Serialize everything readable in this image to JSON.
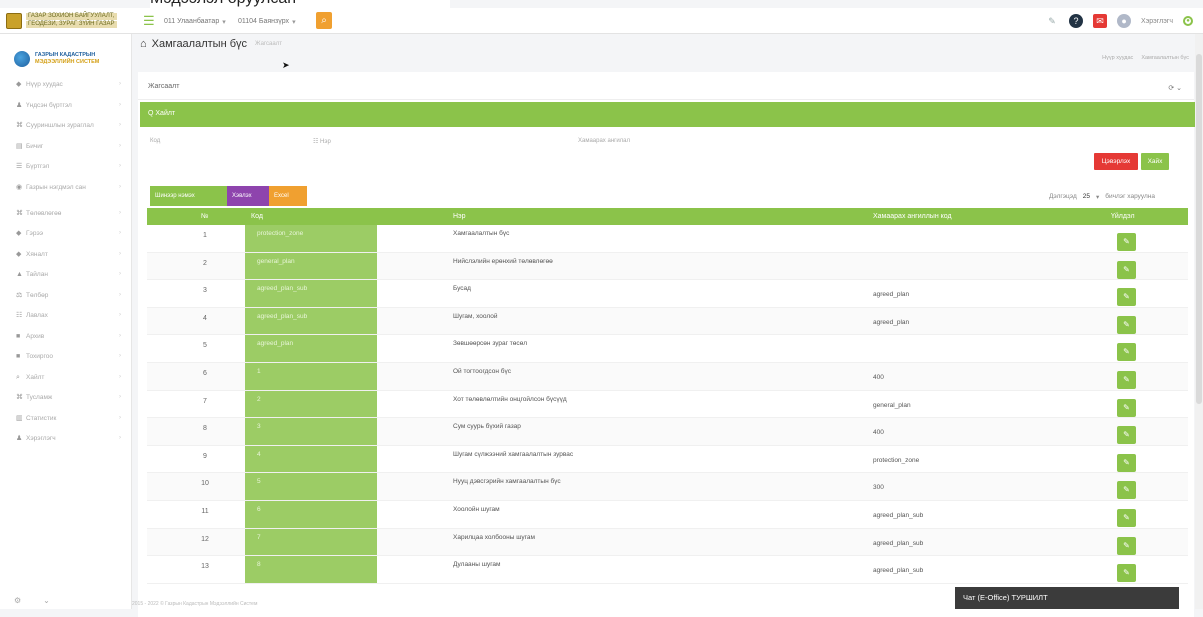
{
  "top_fragment": "Мэдээлэл оруулсан",
  "topbar": {
    "brand_lines": [
      "ГАЗАР ЗОХИОН БАЙГУУЛАЛТ,",
      "ГЕОДЕЗИ, ЗУРАГ ЗҮЙН ГАЗАР"
    ],
    "aimag": "011 Улаанбаатар",
    "district": "01104 Баянзүрх",
    "user": "Хэрэглэгч",
    "icons": [
      "paperclip-icon",
      "help-icon",
      "notification-icon",
      "user-icon",
      "power-icon"
    ]
  },
  "sidebar": {
    "sys_title": [
      "ГАЗРЫН КАДАСТРЫН",
      "МЭДЭЭЛЛИЙН СИСТЕМ"
    ],
    "items": [
      {
        "icon": "home-icon",
        "label": "Нүүр хуудас",
        "glyph": "◆",
        "two": false
      },
      {
        "icon": "user-icon",
        "label": "Үндсэн бүртгэл",
        "glyph": "♟",
        "two": false
      },
      {
        "icon": "map-icon",
        "label": "Сууриншлын зураглал",
        "glyph": "⌘",
        "two": false
      },
      {
        "icon": "doc-icon",
        "label": "Бичиг",
        "glyph": "▤",
        "two": false
      },
      {
        "icon": "list-icon",
        "label": "Бүртгэл",
        "glyph": "☰",
        "two": false
      },
      {
        "icon": "globe-icon",
        "label": "Газрын нэгдмэл сан",
        "glyph": "◉",
        "two": true
      },
      {
        "icon": "settings-icon",
        "label": "Төлөвлөгөө",
        "glyph": "⌘",
        "two": false
      },
      {
        "icon": "file-icon",
        "label": "Гэрээ",
        "glyph": "◆",
        "two": false
      },
      {
        "icon": "check-icon",
        "label": "Хяналт",
        "glyph": "◆",
        "two": false
      },
      {
        "icon": "report-icon",
        "label": "Тайлан",
        "glyph": "▲",
        "two": false
      },
      {
        "icon": "tax-icon",
        "label": "Төлбөр",
        "glyph": "⚖",
        "two": false
      },
      {
        "icon": "table-icon",
        "label": "Лавлах",
        "glyph": "☷",
        "two": false
      },
      {
        "icon": "archive-icon",
        "label": "Архив",
        "glyph": "■",
        "two": false
      },
      {
        "icon": "config-icon",
        "label": "Тохиргоо",
        "glyph": "■",
        "two": false
      },
      {
        "icon": "search-icon",
        "label": "Хайлт",
        "glyph": "⌕",
        "two": false
      },
      {
        "icon": "help-icon",
        "label": "Тусламж",
        "glyph": "⌘",
        "two": false
      },
      {
        "icon": "stats-icon",
        "label": "Статистик",
        "glyph": "▥",
        "two": false
      },
      {
        "icon": "user-icon",
        "label": "Хэрэглэгч",
        "glyph": "♟",
        "two": false
      }
    ]
  },
  "main": {
    "title": "Хамгаалалтын бүс",
    "subtitle": "Жагсаалт",
    "crumbs": [
      "Нүүр хуудас",
      "Хамгаалалтын бүс"
    ],
    "card_label": "Жагсаалт",
    "filter_label": "Q Хайлт",
    "filter_code_label": "Код",
    "filter_name_label": "Нэр",
    "filter_parent_label": "Хамаарах ангилал",
    "btn_clear": "Цэвэрлэх",
    "btn_search": "Хайх",
    "btn_add": "Шинээр нэмэх",
    "btn_print": "Хэвлэх",
    "btn_excel": "Excel",
    "paging_label": "Дэлгэцэд",
    "paging_count": "25",
    "paging_suffix": "бичлэг харуулна",
    "table_headers": [
      "№",
      "Код",
      "Нэр",
      "Хамаарах ангиллын код",
      "Үйлдэл"
    ],
    "rows": [
      {
        "no": "1",
        "code": "protection_zone",
        "name": "Хамгаалалтын бүс",
        "parent": ""
      },
      {
        "no": "2",
        "code": "general_plan",
        "name": "Нийслэлийн ерөнхий төлөвлөгөө",
        "parent": ""
      },
      {
        "no": "3",
        "code": "agreed_plan_sub",
        "name": "Бусад",
        "parent": "agreed_plan"
      },
      {
        "no": "4",
        "code": "agreed_plan_sub",
        "name": "Шугам, хоолой",
        "parent": "agreed_plan"
      },
      {
        "no": "5",
        "code": "agreed_plan",
        "name": "Зөвшөөрсөн зураг төсөл",
        "parent": ""
      },
      {
        "no": "6",
        "code": "1",
        "name": "Ой тогтоогдсон бүс",
        "parent": "400"
      },
      {
        "no": "7",
        "code": "2",
        "name": "Хот төлөвлөлтийн онцгойлсон бүсүүд",
        "parent": "general_plan"
      },
      {
        "no": "8",
        "code": "3",
        "name": "Сум суурь бүхий газар",
        "parent": "400"
      },
      {
        "no": "9",
        "code": "4",
        "name": "Шугам сүлжээний хамгаалалтын зурвас",
        "parent": "protection_zone"
      },
      {
        "no": "10",
        "code": "5",
        "name": "Нууц дэвсгэрийн хамгаалалтын бүс",
        "parent": "300"
      },
      {
        "no": "11",
        "code": "6",
        "name": "Хоолойн шугам",
        "parent": "agreed_plan_sub"
      },
      {
        "no": "12",
        "code": "7",
        "name": "Харилцаа холбооны шугам",
        "parent": "agreed_plan_sub"
      },
      {
        "no": "13",
        "code": "8",
        "name": "Дулааны шугам",
        "parent": "agreed_plan_sub"
      }
    ],
    "footer": "2015 - 2022 © Газрын Кадастрын Мэдээллийн Систем",
    "chat_label": "Чат (E-Office) ТУРШИЛТ"
  }
}
